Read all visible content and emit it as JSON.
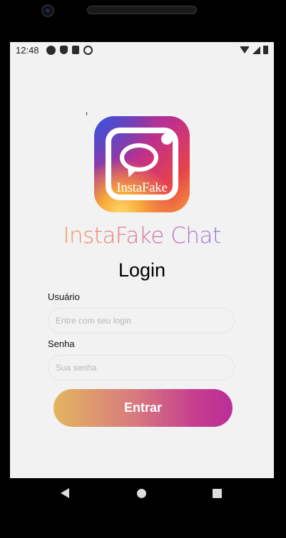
{
  "status_bar": {
    "time": "12:48",
    "left_icons": [
      "android-icon",
      "shield-icon",
      "sd-card-icon",
      "sync-icon"
    ],
    "right_icons": [
      "wifi-icon",
      "signal-icon",
      "battery-icon"
    ]
  },
  "logo": {
    "text": "InstaFake"
  },
  "app_title": "InstaFake Chat",
  "login": {
    "title": "Login",
    "username_label": "Usuário",
    "username_placeholder": "Entre com seu login",
    "password_label": "Senha",
    "password_placeholder": "Sua senha",
    "submit_label": "Entrar"
  },
  "nav_bar": {
    "buttons": [
      "back-icon",
      "home-icon",
      "recents-icon"
    ]
  },
  "colors": {
    "screen_bg": "#f2f2f2",
    "button_gradient_start": "#e2b560",
    "button_gradient_end": "#bb2d98"
  }
}
